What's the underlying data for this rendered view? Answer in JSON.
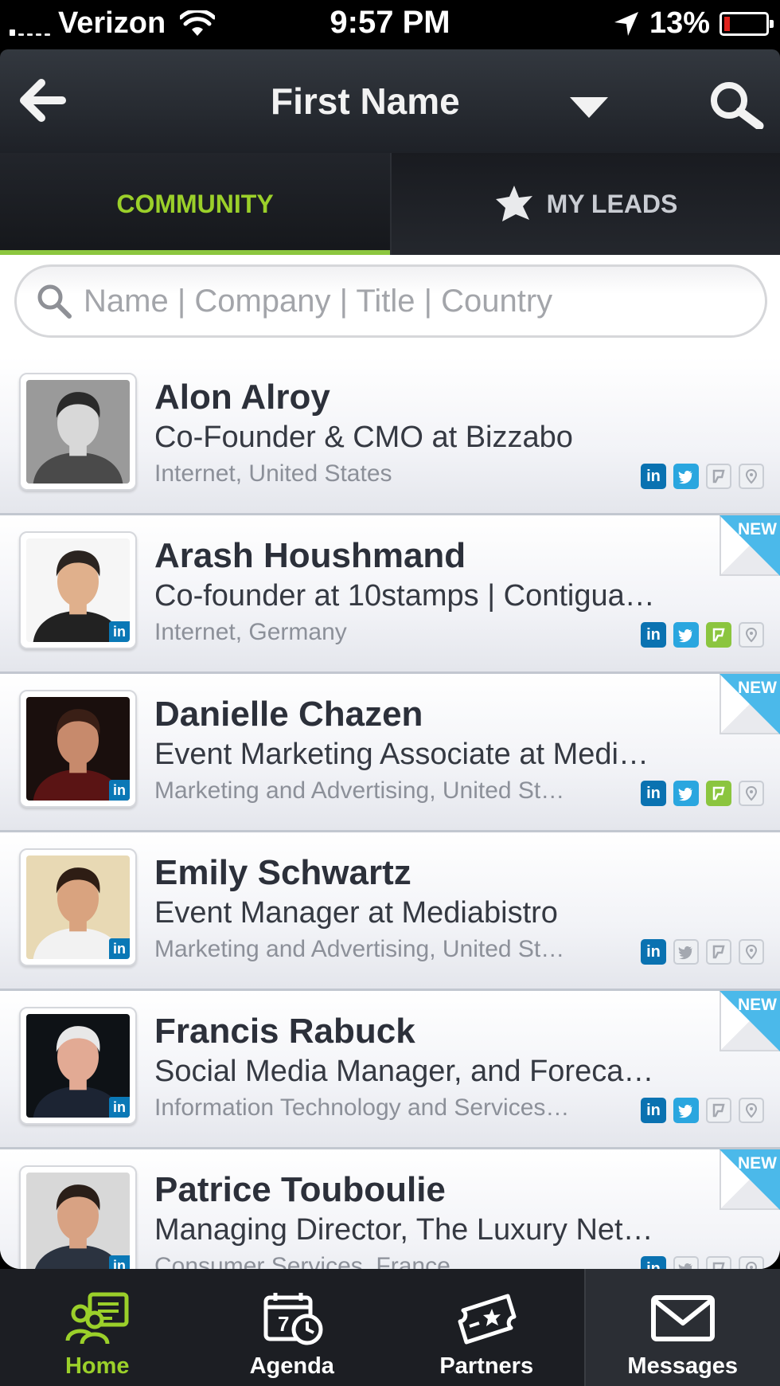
{
  "status_bar": {
    "carrier": "Verizon",
    "time": "9:57 PM",
    "battery": "13%"
  },
  "nav": {
    "title": "First Name"
  },
  "tabs": [
    {
      "label": "COMMUNITY",
      "active": true
    },
    {
      "label": "MY LEADS",
      "active": false
    }
  ],
  "search": {
    "placeholder": "Name | Company | Title | Country",
    "value": ""
  },
  "people": [
    {
      "name": "Alon Alroy",
      "title": "Co-Founder & CMO at Bizzabo",
      "meta": "Internet, United States",
      "new": false,
      "linkedin_badge": false,
      "socials": {
        "linkedin": true,
        "twitter": true,
        "foursquare": false,
        "location": false
      }
    },
    {
      "name": "Arash Houshmand",
      "title": "Co-founder at 10stamps | Contigua…",
      "meta": "Internet, Germany",
      "new": true,
      "linkedin_badge": true,
      "socials": {
        "linkedin": true,
        "twitter": true,
        "foursquare": true,
        "location": false
      }
    },
    {
      "name": "Danielle Chazen",
      "title": "Event Marketing Associate at Medi…",
      "meta": "Marketing and Advertising, United St…",
      "new": true,
      "linkedin_badge": true,
      "socials": {
        "linkedin": true,
        "twitter": true,
        "foursquare": true,
        "location": false
      }
    },
    {
      "name": "Emily Schwartz",
      "title": "Event Manager at Mediabistro",
      "meta": "Marketing and Advertising, United St…",
      "new": false,
      "linkedin_badge": true,
      "socials": {
        "linkedin": true,
        "twitter": false,
        "foursquare": false,
        "location": false
      }
    },
    {
      "name": "Francis Rabuck",
      "title": "Social Media Manager, and Foreca…",
      "meta": "Information Technology and Services…",
      "new": true,
      "linkedin_badge": true,
      "socials": {
        "linkedin": true,
        "twitter": true,
        "foursquare": false,
        "location": false
      }
    },
    {
      "name": "Patrice Touboulie",
      "title": "Managing Director, The Luxury Net…",
      "meta": "Consumer Services, France",
      "new": true,
      "linkedin_badge": true,
      "socials": {
        "linkedin": true,
        "twitter": false,
        "foursquare": false,
        "location": false
      }
    }
  ],
  "new_label": "NEW",
  "linkedin_label": "in",
  "tab_bar": [
    {
      "label": "Home",
      "icon": "home-community-icon",
      "active": true
    },
    {
      "label": "Agenda",
      "icon": "agenda-calendar-icon",
      "active": false
    },
    {
      "label": "Partners",
      "icon": "partners-ticket-icon",
      "active": false
    },
    {
      "label": "Messages",
      "icon": "messages-envelope-icon",
      "active": false
    }
  ],
  "colors": {
    "accent_green": "#8cc63f",
    "linkedin": "#0a72b1",
    "twitter": "#2aa6df",
    "new_ribbon": "#4bb9ea",
    "nav_dark": "#1e2127"
  }
}
